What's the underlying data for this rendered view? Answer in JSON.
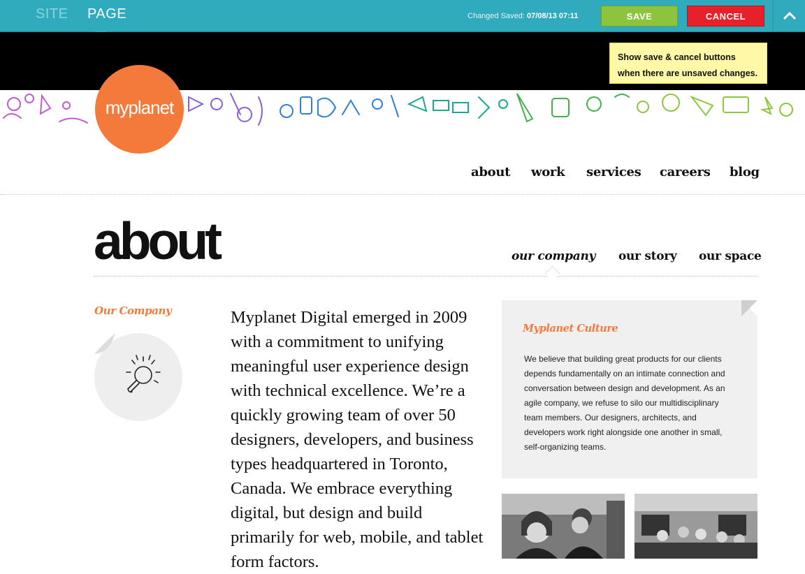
{
  "adminbar": {
    "tabs": [
      {
        "label": "SITE"
      },
      {
        "label": "PAGE"
      }
    ],
    "status_prefix": "Changed Saved:",
    "status_value": "07/08/13 07:11",
    "save_label": "SAVE",
    "cancel_label": "CANCEL"
  },
  "tooltip": {
    "line1": "Show save & cancel buttons",
    "line2": "when there are unsaved changes."
  },
  "logo": {
    "text": "myplanet"
  },
  "nav": {
    "items": [
      {
        "label": "about"
      },
      {
        "label": "work"
      },
      {
        "label": "services"
      },
      {
        "label": "careers"
      },
      {
        "label": "blog"
      }
    ]
  },
  "page": {
    "title": "about",
    "subnav": [
      {
        "label": "our company"
      },
      {
        "label": "our story"
      },
      {
        "label": "our space"
      }
    ],
    "section_label": "Our Company",
    "lines": [
      "Myplanet Digital emerged in 2009",
      "with a commitment to unifying",
      "meaningful user experience design",
      "with technical excellence. We’re a",
      "quickly growing team of over 50",
      "designers, developers, and business",
      "types headquartered in Toronto,",
      "Canada. We embrace everything",
      "digital, but design and build",
      "primarily for web, mobile, and tablet",
      "form factors."
    ]
  },
  "culture": {
    "title": "Myplanet Culture",
    "text": "We believe that building great products for our clients depends fundamentally on an intimate connection and conversation between design and development. As an agile company, we refuse to silo our multidisciplinary team members. Our designers, architects, and developers work right alongside one another in small, self-organizing teams."
  },
  "colors": {
    "adminbar": "#2fabbd",
    "save": "#8cc43e",
    "cancel": "#e8202a",
    "brand_orange": "#f47a3b",
    "tooltip": "#fff8a6"
  }
}
